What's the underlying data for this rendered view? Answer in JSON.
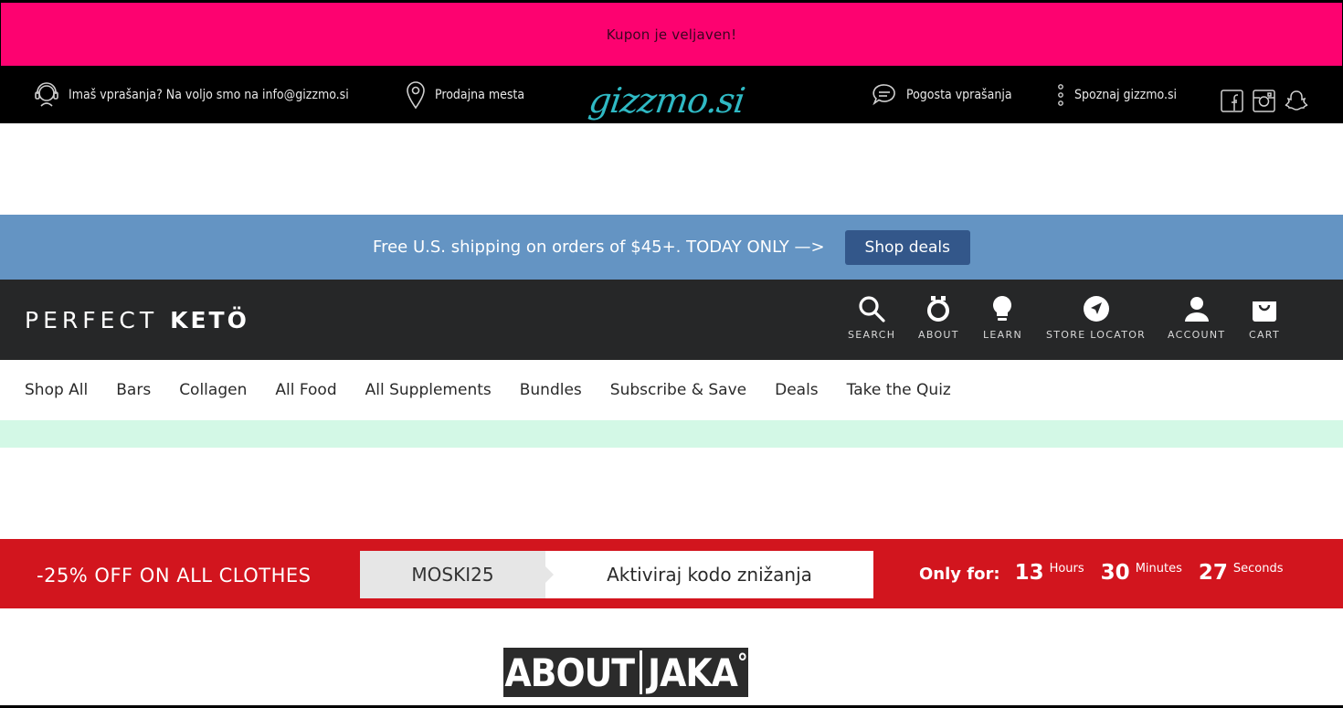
{
  "coupon_bar": {
    "message": "Kupon je veljaven!"
  },
  "gizzmo": {
    "contact_text": "Imaš vprašanja? Na voljo smo na info@gizzmo.si",
    "stores_link": "Prodajna mesta",
    "logo_text": "gizzmo.si",
    "faq_link": "Pogosta vprašanja",
    "about_link": "Spoznaj gizzmo.si",
    "accent_color": "#2fb9c4"
  },
  "shipping_bar": {
    "text": "Free U.S. shipping on orders of $45+.  TODAY ONLY —>",
    "button_label": "Shop deals",
    "background": "#6494c3"
  },
  "perfect_keto": {
    "logo_light": "PERFECT",
    "logo_bold": "KETÖ",
    "nav": {
      "search": "SEARCH",
      "about": "ABOUT",
      "learn": "LEARN",
      "store_locator": "STORE LOCATOR",
      "account": "ACCOUNT",
      "cart": "CART"
    }
  },
  "categories": [
    "Shop All",
    "Bars",
    "Collagen",
    "All Food",
    "All Supplements",
    "Bundles",
    "Subscribe & Save",
    "Deals",
    "Take the Quiz"
  ],
  "promo": {
    "headline": "-25% OFF ON ALL CLOTHES",
    "code": "MOSKI25",
    "cta": "Aktiviraj kodo znižanja",
    "timer_lead": "Only for:",
    "hours": "13",
    "hours_label": "Hours",
    "minutes": "30",
    "minutes_label": "Minutes",
    "seconds": "27",
    "seconds_label": "Seconds",
    "background": "#d2151e"
  },
  "about_jaka": {
    "left": "ABOUT",
    "right": "JAKA",
    "mark": "°"
  }
}
